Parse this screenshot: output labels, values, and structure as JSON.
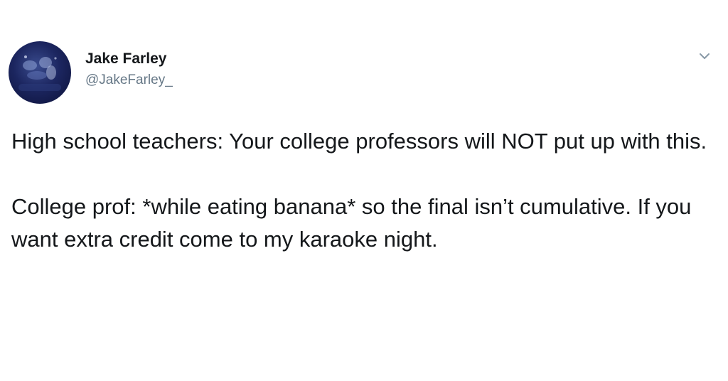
{
  "author": {
    "display_name": "Jake Farley",
    "handle": "@JakeFarley_",
    "avatar_icon": "avatar-image"
  },
  "header": {
    "more_icon": "chevron-down-icon"
  },
  "tweet": {
    "paragraphs": [
      "High school teachers: Your college professors will NOT put up with this.",
      "College prof: *while eating banana* so the final isn’t cumulative. If you want extra credit come to my karaoke night."
    ]
  },
  "colors": {
    "text": "#14171a",
    "secondary_text": "#657786",
    "icon": "#8899a6",
    "background": "#ffffff"
  }
}
